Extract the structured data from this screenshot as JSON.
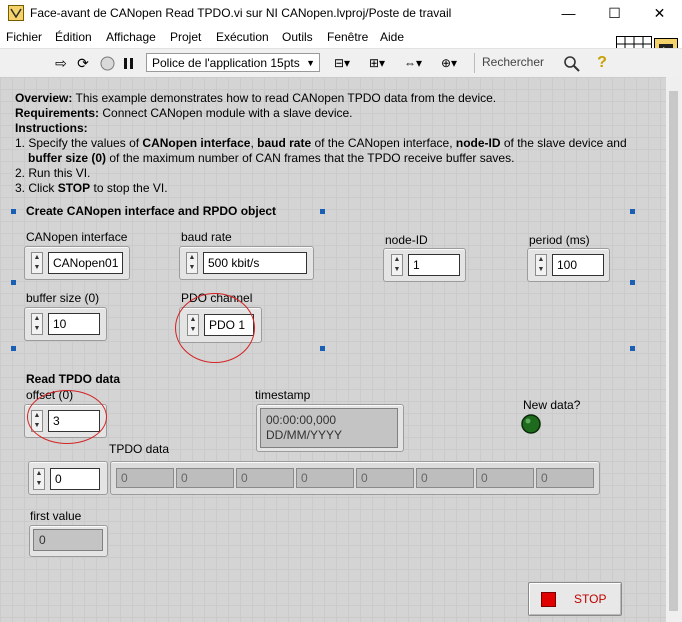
{
  "window": {
    "title": "Face-avant de CANopen Read TPDO.vi sur NI CANopen.lvproj/Poste de travail",
    "minimize_glyph": "—",
    "maximize_glyph": "☐",
    "close_glyph": "✕"
  },
  "menu": [
    "Fichier",
    "Édition",
    "Affichage",
    "Projet",
    "Exécution",
    "Outils",
    "Fenêtre",
    "Aide"
  ],
  "toolbar": {
    "font": "Police de l'application 15pts",
    "search_placeholder": "Rechercher",
    "icons": [
      "run-arrow-icon",
      "run-continuously-icon",
      "abort-icon",
      "pause-icon",
      "align-icon",
      "distribute-icon",
      "resize-icon",
      "reorder-icon",
      "search-icon",
      "help-icon"
    ]
  },
  "description": {
    "overview_label": "Overview:",
    "overview_text": " This example demonstrates how to read CANopen TPDO data from the device.",
    "requirements_label": "Requirements:",
    "requirements_text": " Connect CANopen module with a slave device.",
    "instructions_label": "Instructions:",
    "step1_a": "1. Specify the values of ",
    "step1_b": "CANopen interface",
    "step1_c": ", ",
    "step1_d": "baud rate",
    "step1_e": " of the CANopen interface, ",
    "step1_f": "node-ID",
    "step1_g": " of the slave device and",
    "step1_h": "buffer size (0)",
    "step1_i": " of the maximum number of CAN frames that the TPDO receive buffer saves.",
    "step2": "2. Run this VI.",
    "step3_a": "3. Click ",
    "step3_b": "STOP",
    "step3_c": " to stop the VI."
  },
  "create_section": {
    "title": "Create CANopen interface and RPDO object",
    "canopen_interface": {
      "label": "CANopen interface",
      "value": "CANopen01"
    },
    "baud_rate": {
      "label": "baud rate",
      "value": "500 kbit/s"
    },
    "node_id": {
      "label": "node-ID",
      "value": "1"
    },
    "period": {
      "label": "period (ms)",
      "value": "100"
    },
    "buffer_size": {
      "label": "buffer size (0)",
      "value": "10"
    },
    "pdo_channel": {
      "label": "PDO channel",
      "value": "PDO 1"
    }
  },
  "read_section": {
    "title": "Read TPDO data",
    "offset": {
      "label": "offset (0)",
      "value": "3"
    },
    "timestamp": {
      "label": "timestamp",
      "line1": "00:00:00,000",
      "line2": "DD/MM/YYYY"
    },
    "new_data": {
      "label": "New data?",
      "led_color": "#1e6b1e"
    },
    "tpdo_data": {
      "label": "TPDO data",
      "index": "0",
      "values": [
        "0",
        "0",
        "0",
        "0",
        "0",
        "0",
        "0",
        "0"
      ]
    },
    "first_value": {
      "label": "first value",
      "value": "0"
    }
  },
  "stop_button": {
    "label": "STOP",
    "color": "#e00000"
  }
}
